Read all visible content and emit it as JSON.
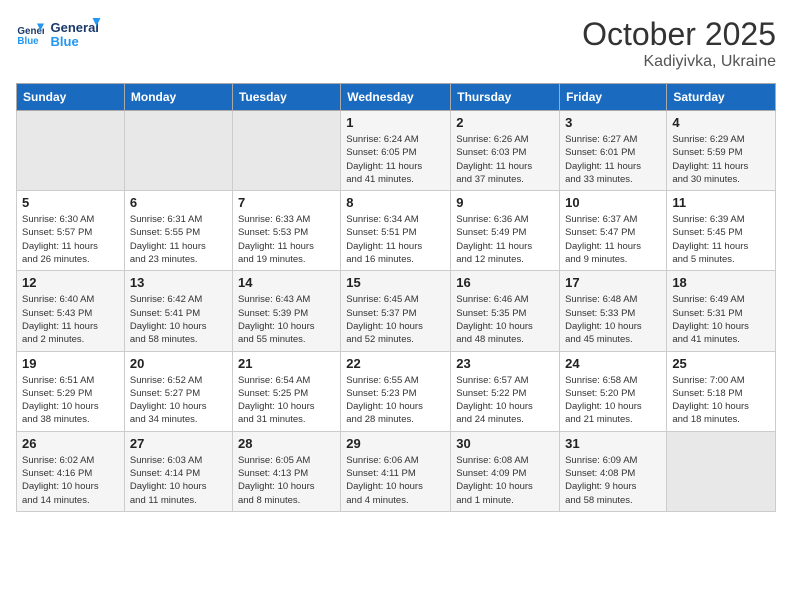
{
  "header": {
    "logo_line1": "General",
    "logo_line2": "Blue",
    "month": "October 2025",
    "location": "Kadiyivka, Ukraine"
  },
  "weekdays": [
    "Sunday",
    "Monday",
    "Tuesday",
    "Wednesday",
    "Thursday",
    "Friday",
    "Saturday"
  ],
  "weeks": [
    [
      {
        "day": "",
        "info": ""
      },
      {
        "day": "",
        "info": ""
      },
      {
        "day": "",
        "info": ""
      },
      {
        "day": "1",
        "info": "Sunrise: 6:24 AM\nSunset: 6:05 PM\nDaylight: 11 hours\nand 41 minutes."
      },
      {
        "day": "2",
        "info": "Sunrise: 6:26 AM\nSunset: 6:03 PM\nDaylight: 11 hours\nand 37 minutes."
      },
      {
        "day": "3",
        "info": "Sunrise: 6:27 AM\nSunset: 6:01 PM\nDaylight: 11 hours\nand 33 minutes."
      },
      {
        "day": "4",
        "info": "Sunrise: 6:29 AM\nSunset: 5:59 PM\nDaylight: 11 hours\nand 30 minutes."
      }
    ],
    [
      {
        "day": "5",
        "info": "Sunrise: 6:30 AM\nSunset: 5:57 PM\nDaylight: 11 hours\nand 26 minutes."
      },
      {
        "day": "6",
        "info": "Sunrise: 6:31 AM\nSunset: 5:55 PM\nDaylight: 11 hours\nand 23 minutes."
      },
      {
        "day": "7",
        "info": "Sunrise: 6:33 AM\nSunset: 5:53 PM\nDaylight: 11 hours\nand 19 minutes."
      },
      {
        "day": "8",
        "info": "Sunrise: 6:34 AM\nSunset: 5:51 PM\nDaylight: 11 hours\nand 16 minutes."
      },
      {
        "day": "9",
        "info": "Sunrise: 6:36 AM\nSunset: 5:49 PM\nDaylight: 11 hours\nand 12 minutes."
      },
      {
        "day": "10",
        "info": "Sunrise: 6:37 AM\nSunset: 5:47 PM\nDaylight: 11 hours\nand 9 minutes."
      },
      {
        "day": "11",
        "info": "Sunrise: 6:39 AM\nSunset: 5:45 PM\nDaylight: 11 hours\nand 5 minutes."
      }
    ],
    [
      {
        "day": "12",
        "info": "Sunrise: 6:40 AM\nSunset: 5:43 PM\nDaylight: 11 hours\nand 2 minutes."
      },
      {
        "day": "13",
        "info": "Sunrise: 6:42 AM\nSunset: 5:41 PM\nDaylight: 10 hours\nand 58 minutes."
      },
      {
        "day": "14",
        "info": "Sunrise: 6:43 AM\nSunset: 5:39 PM\nDaylight: 10 hours\nand 55 minutes."
      },
      {
        "day": "15",
        "info": "Sunrise: 6:45 AM\nSunset: 5:37 PM\nDaylight: 10 hours\nand 52 minutes."
      },
      {
        "day": "16",
        "info": "Sunrise: 6:46 AM\nSunset: 5:35 PM\nDaylight: 10 hours\nand 48 minutes."
      },
      {
        "day": "17",
        "info": "Sunrise: 6:48 AM\nSunset: 5:33 PM\nDaylight: 10 hours\nand 45 minutes."
      },
      {
        "day": "18",
        "info": "Sunrise: 6:49 AM\nSunset: 5:31 PM\nDaylight: 10 hours\nand 41 minutes."
      }
    ],
    [
      {
        "day": "19",
        "info": "Sunrise: 6:51 AM\nSunset: 5:29 PM\nDaylight: 10 hours\nand 38 minutes."
      },
      {
        "day": "20",
        "info": "Sunrise: 6:52 AM\nSunset: 5:27 PM\nDaylight: 10 hours\nand 34 minutes."
      },
      {
        "day": "21",
        "info": "Sunrise: 6:54 AM\nSunset: 5:25 PM\nDaylight: 10 hours\nand 31 minutes."
      },
      {
        "day": "22",
        "info": "Sunrise: 6:55 AM\nSunset: 5:23 PM\nDaylight: 10 hours\nand 28 minutes."
      },
      {
        "day": "23",
        "info": "Sunrise: 6:57 AM\nSunset: 5:22 PM\nDaylight: 10 hours\nand 24 minutes."
      },
      {
        "day": "24",
        "info": "Sunrise: 6:58 AM\nSunset: 5:20 PM\nDaylight: 10 hours\nand 21 minutes."
      },
      {
        "day": "25",
        "info": "Sunrise: 7:00 AM\nSunset: 5:18 PM\nDaylight: 10 hours\nand 18 minutes."
      }
    ],
    [
      {
        "day": "26",
        "info": "Sunrise: 6:02 AM\nSunset: 4:16 PM\nDaylight: 10 hours\nand 14 minutes."
      },
      {
        "day": "27",
        "info": "Sunrise: 6:03 AM\nSunset: 4:14 PM\nDaylight: 10 hours\nand 11 minutes."
      },
      {
        "day": "28",
        "info": "Sunrise: 6:05 AM\nSunset: 4:13 PM\nDaylight: 10 hours\nand 8 minutes."
      },
      {
        "day": "29",
        "info": "Sunrise: 6:06 AM\nSunset: 4:11 PM\nDaylight: 10 hours\nand 4 minutes."
      },
      {
        "day": "30",
        "info": "Sunrise: 6:08 AM\nSunset: 4:09 PM\nDaylight: 10 hours\nand 1 minute."
      },
      {
        "day": "31",
        "info": "Sunrise: 6:09 AM\nSunset: 4:08 PM\nDaylight: 9 hours\nand 58 minutes."
      },
      {
        "day": "",
        "info": ""
      }
    ]
  ]
}
